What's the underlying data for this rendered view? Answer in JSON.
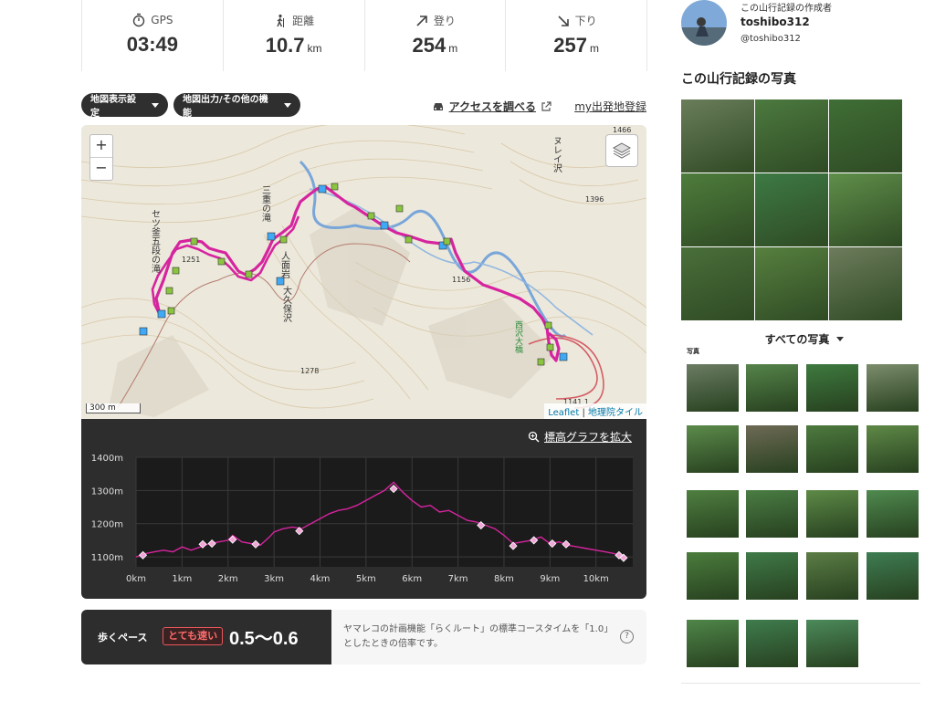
{
  "stats": [
    {
      "icon": "stopwatch-icon",
      "label": "GPS",
      "value": "03:49",
      "unit": ""
    },
    {
      "icon": "hiker-icon",
      "label": "距離",
      "value": "10.7",
      "unit": "km"
    },
    {
      "icon": "arrow-up-right-icon",
      "label": "登り",
      "value": "254",
      "unit": "m"
    },
    {
      "icon": "arrow-down-right-icon",
      "label": "下り",
      "value": "257",
      "unit": "m"
    }
  ],
  "toolbar": {
    "map_settings": "地図表示設定",
    "export": "地図出力/その他の機能",
    "access": "アクセスを調べる",
    "my_start": "my出発地登録"
  },
  "map": {
    "zoom_in": "+",
    "zoom_out": "−",
    "scale": "300 m",
    "attribution_leaflet": "Leaflet",
    "attribution_sep": " | ",
    "attribution_tile": "地理院タイル",
    "labels": [
      "1466",
      "1396",
      "1251",
      "1156",
      "1278",
      "1141.1",
      "西沢大橋",
      "セツ釜五段の滝",
      "三重の滝",
      "人面岩",
      "大久保沢",
      "ヌレイ沢"
    ]
  },
  "elevation": {
    "expand_label": "標高グラフを拡大",
    "accent": "#d6249f"
  },
  "chart_data": {
    "type": "line",
    "title": "",
    "xlabel": "",
    "ylabel": "",
    "x_ticks": [
      "0km",
      "1km",
      "2km",
      "3km",
      "4km",
      "5km",
      "6km",
      "7km",
      "8km",
      "9km",
      "10km"
    ],
    "y_ticks": [
      "1100m",
      "1200m",
      "1300m",
      "1400m"
    ],
    "xlim": [
      0,
      10.8
    ],
    "ylim": [
      1070,
      1400
    ],
    "grid": true,
    "series": [
      {
        "x": [
          0,
          0.2,
          0.4,
          0.6,
          0.8,
          1.0,
          1.2,
          1.4,
          1.6,
          1.8,
          2.0,
          2.1,
          2.3,
          2.5,
          2.7,
          2.9,
          3.0,
          3.2,
          3.4,
          3.6,
          3.8,
          4.0,
          4.2,
          4.4,
          4.6,
          4.8,
          5.0,
          5.2,
          5.4,
          5.6,
          5.8,
          6.0,
          6.2,
          6.4,
          6.6,
          6.8,
          7.0,
          7.2,
          7.4,
          7.6,
          7.8,
          8.0,
          8.2,
          8.4,
          8.6,
          8.8,
          9.0,
          9.2,
          9.4,
          9.6,
          9.8,
          10.0,
          10.2,
          10.4,
          10.6
        ],
        "y": [
          1100,
          1110,
          1115,
          1120,
          1115,
          1130,
          1120,
          1130,
          1140,
          1145,
          1150,
          1165,
          1145,
          1140,
          1135,
          1160,
          1175,
          1185,
          1190,
          1185,
          1200,
          1215,
          1230,
          1240,
          1245,
          1255,
          1270,
          1285,
          1300,
          1325,
          1295,
          1270,
          1250,
          1255,
          1235,
          1240,
          1225,
          1210,
          1205,
          1195,
          1185,
          1165,
          1140,
          1145,
          1150,
          1160,
          1140,
          1145,
          1135,
          1130,
          1125,
          1120,
          1115,
          1110,
          1100
        ]
      }
    ],
    "markers": [
      {
        "x": 0.15,
        "y": 1105
      },
      {
        "x": 1.45,
        "y": 1138
      },
      {
        "x": 1.65,
        "y": 1140
      },
      {
        "x": 2.1,
        "y": 1152
      },
      {
        "x": 2.6,
        "y": 1138
      },
      {
        "x": 3.55,
        "y": 1178
      },
      {
        "x": 5.6,
        "y": 1305
      },
      {
        "x": 7.5,
        "y": 1195
      },
      {
        "x": 8.2,
        "y": 1133
      },
      {
        "x": 8.65,
        "y": 1150
      },
      {
        "x": 9.05,
        "y": 1140
      },
      {
        "x": 9.35,
        "y": 1138
      },
      {
        "x": 10.5,
        "y": 1105
      },
      {
        "x": 10.6,
        "y": 1097
      }
    ]
  },
  "pace": {
    "label": "歩くペース",
    "badge": "とても速い",
    "value": "0.5〜0.6",
    "description": "ヤマレコの計画機能「らくルート」の標準コースタイムを「1.0」としたときの倍率です。"
  },
  "author": {
    "caption": "この山行記録の作成者",
    "name": "toshibo312",
    "handle": "@toshibo312"
  },
  "photos": {
    "title": "この山行記録の写真",
    "all_label": "すべての写真",
    "section": "写真",
    "grid_colors": [
      "#6a7d5a",
      "#4c7a3f",
      "#3f6e35",
      "#4e7d3c",
      "#3d7a44",
      "#5f8f4a",
      "#4a6f3a",
      "#57803f",
      "#6d7c5c"
    ],
    "thumb_colors": [
      "#6b7d63",
      "#55844a",
      "#3e7a3f",
      "#7c8d6c",
      "#5c8b4b",
      "#6e6a55",
      "#4d7a3e",
      "#5f8947",
      "#4f7f40",
      "#4a7d44",
      "#5d8a47",
      "#4f8a4f",
      "#4b7d3d",
      "#3f7a48",
      "#5b7d45",
      "#3e7d52",
      "#4f8649",
      "#3f7c4e",
      "#4c8a5b"
    ]
  }
}
